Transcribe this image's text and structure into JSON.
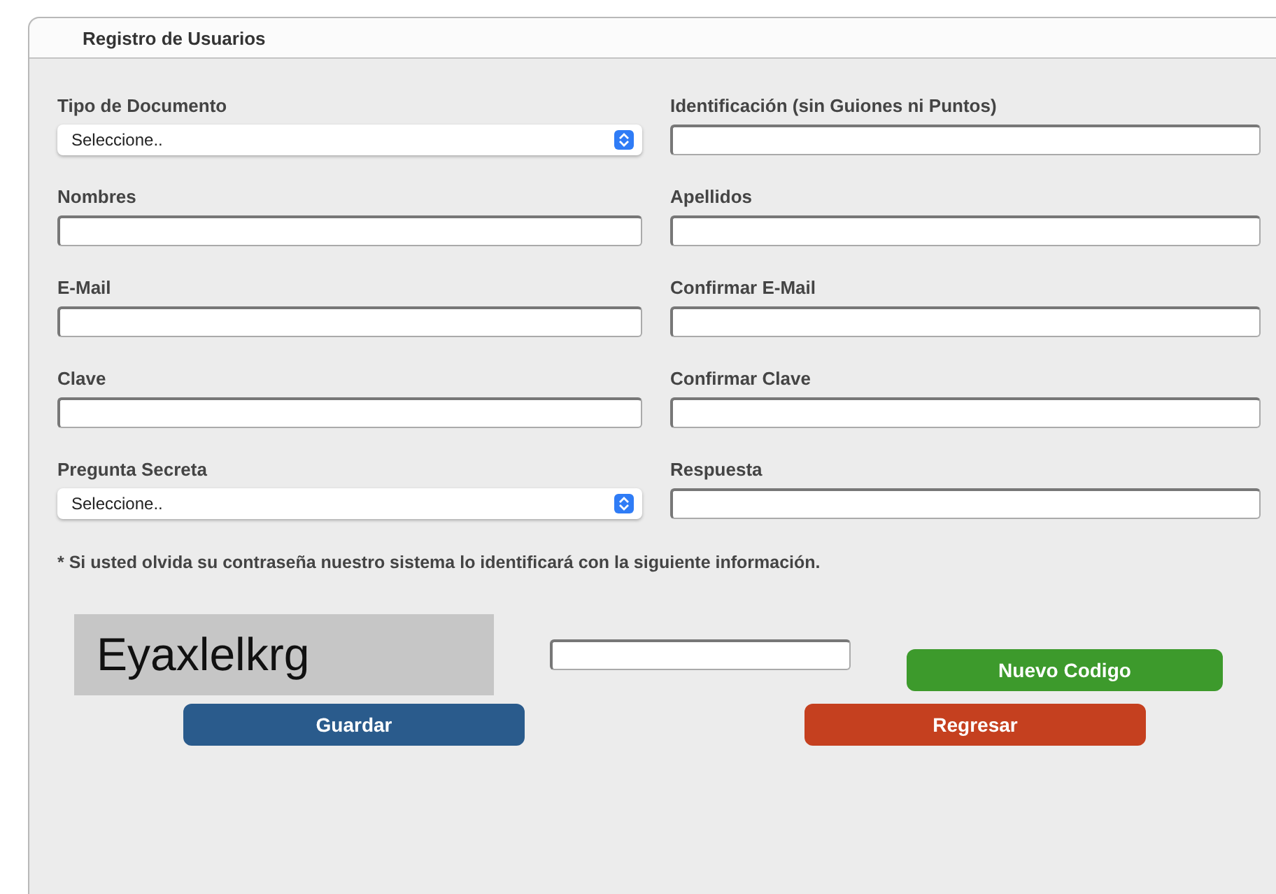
{
  "panel": {
    "title": "Registro de Usuarios"
  },
  "fields": [
    {
      "label": "Tipo de Documento",
      "kind": "select",
      "value": "Seleccione.."
    },
    {
      "label": "Identificación (sin Guiones ni Puntos)",
      "kind": "text"
    },
    {
      "label": "Nombres",
      "kind": "text"
    },
    {
      "label": "Apellidos",
      "kind": "text"
    },
    {
      "label": "E-Mail",
      "kind": "text"
    },
    {
      "label": "Confirmar E-Mail",
      "kind": "text"
    },
    {
      "label": "Clave",
      "kind": "text"
    },
    {
      "label": "Confirmar Clave",
      "kind": "text"
    },
    {
      "label": "Pregunta Secreta",
      "kind": "select",
      "value": "Seleccione.."
    },
    {
      "label": "Respuesta",
      "kind": "text"
    }
  ],
  "note": "* Si usted olvida su contraseña nuestro sistema lo identificará con la siguiente información.",
  "captcha": {
    "code": "Eyaxlelkrg",
    "refresh_button": "Nuevo Codigo"
  },
  "buttons": [
    {
      "label": "Guardar",
      "color": "#2a5b8c"
    },
    {
      "label": "Regresar",
      "color": "#c5401f"
    }
  ]
}
